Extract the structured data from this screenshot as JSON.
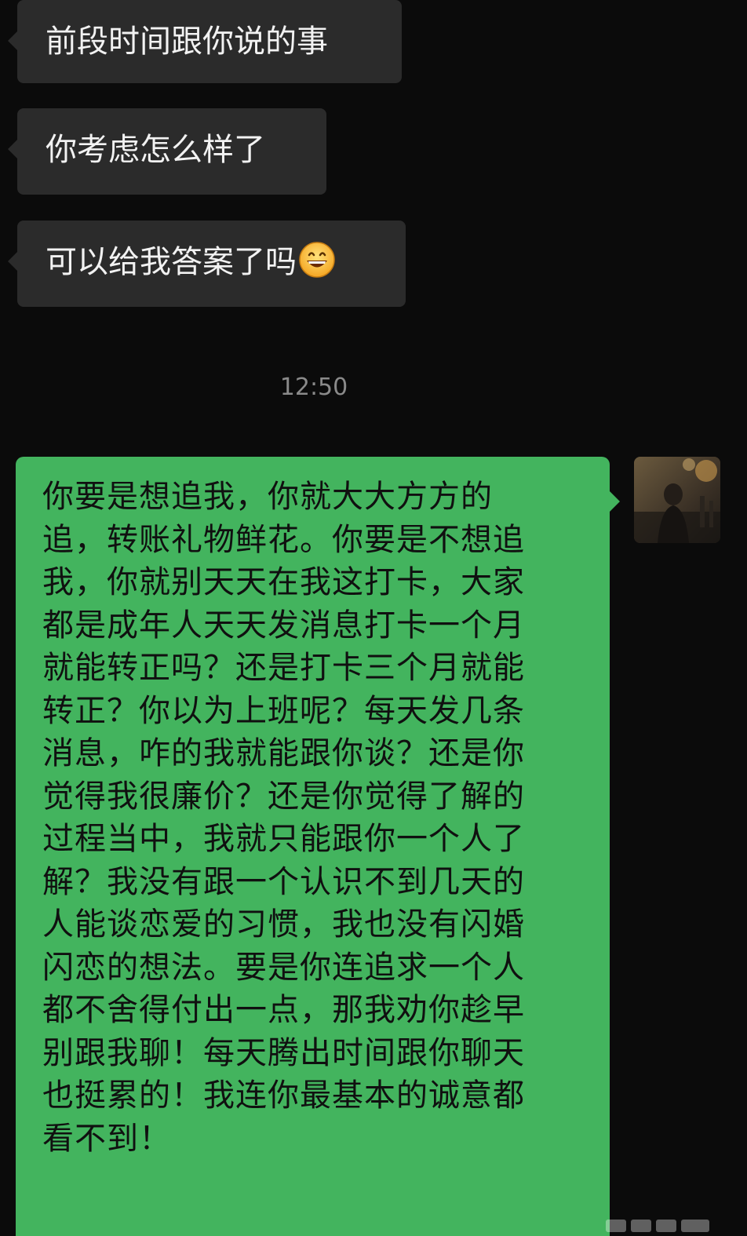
{
  "chat": {
    "incoming_messages": [
      {
        "text": "前段时间跟你说的事"
      },
      {
        "text": "你考虑怎么样了"
      },
      {
        "text": "可以给我答案了吗",
        "emoji": "grinning-face-emoji"
      }
    ],
    "timestamp": "12:50",
    "outgoing_message": {
      "lines": [
        "你要是想追我，你就大大方方的",
        "追，转账礼物鲜花。你要是不想追",
        "我，你就别天天在我这打卡，大家",
        "都是成年人天天发消息打卡一个月",
        "就能转正吗？还是打卡三个月就能",
        "转正？你以为上班呢？每天发几条",
        "消息，咋的我就能跟你谈？还是你",
        "觉得我很廉价？还是你觉得了解的",
        "过程当中，我就只能跟你一个人了",
        "解？我没有跟一个认识不到几天的",
        "人能谈恋爱的习惯，我也没有闪婚",
        "闪恋的想法。要是你连追求一个人",
        "都不舍得付出一点，那我劝你趁早",
        "别跟我聊！每天腾出时间跟你聊天",
        "也挺累的！我连你最基本的诚意都",
        "看不到！"
      ]
    }
  },
  "colors": {
    "background": "#0b0b0b",
    "incoming_bubble": "#2b2b2b",
    "outgoing_bubble": "#43b45e",
    "timestamp": "#8a8a8a"
  }
}
